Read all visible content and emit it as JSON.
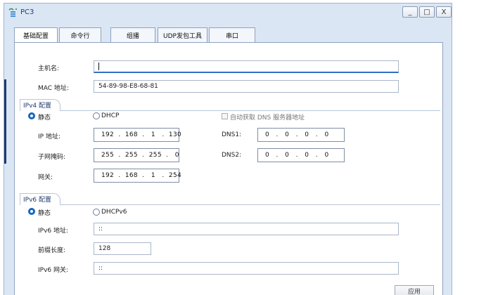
{
  "window": {
    "title": "PC3",
    "minimize": "_",
    "maximize": "□",
    "close": "X"
  },
  "tabs": [
    {
      "label": "基础配置",
      "active": true
    },
    {
      "label": "命令行",
      "active": false
    },
    {
      "label": "组播",
      "active": false
    },
    {
      "label": "UDP发包工具",
      "active": false
    },
    {
      "label": "串口",
      "active": false
    }
  ],
  "host": {
    "label": "主机名:",
    "value": ""
  },
  "mac": {
    "label": "MAC 地址:",
    "value": "54-89-98-E8-68-81"
  },
  "ipv4": {
    "title": "IPv4 配置",
    "static_label": "静态",
    "dhcp_label": "DHCP",
    "auto_dns_label": "自动获取 DNS 服务器地址",
    "ip_label": "IP 地址:",
    "ip_value": "192  .  168  .   1   .  130",
    "mask_label": "子网掩码:",
    "mask_value": "255  .  255  .  255  .   0",
    "gateway_label": "网关:",
    "gateway_value": "192  .  168  .   1   .  254",
    "dns1_label": "DNS1:",
    "dns1_value": "0   .   0   .   0   .   0",
    "dns2_label": "DNS2:",
    "dns2_value": "0   .   0   .   0   .   0"
  },
  "ipv6": {
    "title": "IPv6 配置",
    "static_label": "静态",
    "dhcp_label": "DHCPv6",
    "addr_label": "IPv6 地址:",
    "addr_value": "::",
    "prefix_label": "前缀长度:",
    "prefix_value": "128",
    "gateway_label": "IPv6 网关:",
    "gateway_value": "::"
  },
  "apply_label": "应用"
}
